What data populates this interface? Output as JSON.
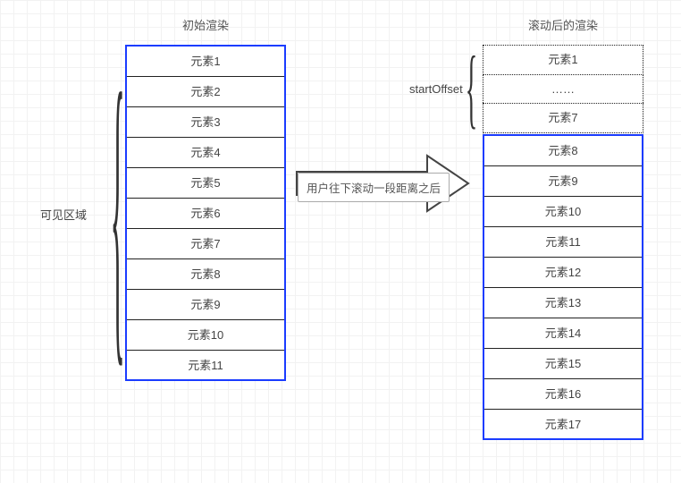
{
  "titles": {
    "left": "初始渲染",
    "right": "滚动后的渲染"
  },
  "labels": {
    "visibleArea": "可见区域",
    "startOffset": "startOffset"
  },
  "arrow": {
    "caption": "用户往下滚动一段距离之后"
  },
  "leftList": {
    "items": [
      "元素1",
      "元素2",
      "元素3",
      "元素4",
      "元素5",
      "元素6",
      "元素7",
      "元素8",
      "元素9",
      "元素10",
      "元素11"
    ]
  },
  "rightOffset": {
    "items": [
      "元素1",
      "……",
      "元素7"
    ]
  },
  "rightList": {
    "items": [
      "元素8",
      "元素9",
      "元素10",
      "元素11",
      "元素12",
      "元素13",
      "元素14",
      "元素15",
      "元素16",
      "元素17"
    ]
  }
}
